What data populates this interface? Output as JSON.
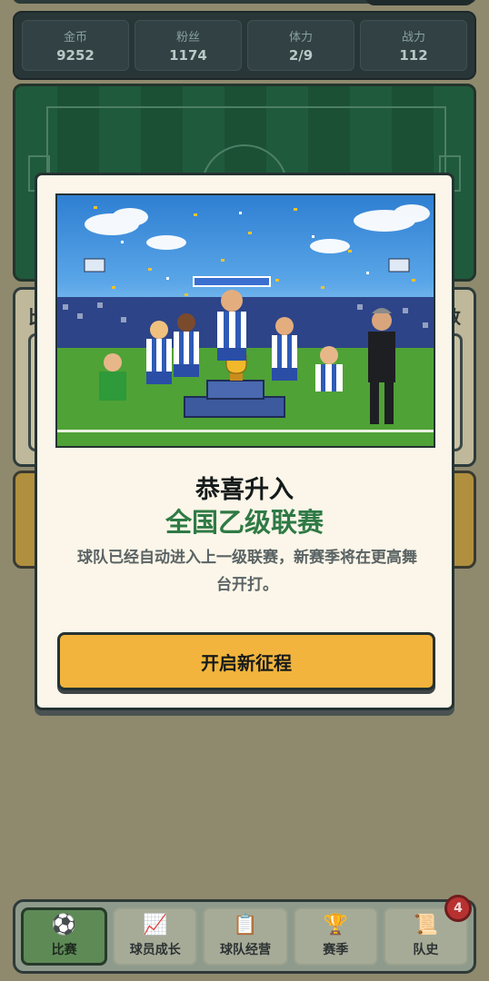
{
  "stats": [
    {
      "label": "金币",
      "value": "9252"
    },
    {
      "label": "粉丝",
      "value": "1174"
    },
    {
      "label": "体力",
      "value": "2/9"
    },
    {
      "label": "战力",
      "value": "112"
    }
  ],
  "background_panel": {
    "left_text": "比",
    "right_text": "数"
  },
  "modal": {
    "title": "恭喜升入",
    "league": "全国乙级联赛",
    "description": "球队已经自动进入上一级联赛，新赛季将在更高舞台开打。",
    "button_label": "开启新征程"
  },
  "nav": {
    "items": [
      {
        "label": "比赛",
        "icon": "soccer-ball-icon",
        "glyph": "⚽",
        "active": true
      },
      {
        "label": "球员成长",
        "icon": "growth-chart-icon",
        "glyph": "📈",
        "active": false
      },
      {
        "label": "球队经营",
        "icon": "clipboard-icon",
        "glyph": "📋",
        "active": false
      },
      {
        "label": "赛季",
        "icon": "trophy-icon",
        "glyph": "🏆",
        "active": false
      },
      {
        "label": "队史",
        "icon": "scroll-icon",
        "glyph": "📜",
        "active": false
      }
    ],
    "history_badge": "4"
  },
  "colors": {
    "accent_gold": "#f2b43c",
    "league_green": "#2f7a45",
    "badge_red": "#b83131"
  }
}
